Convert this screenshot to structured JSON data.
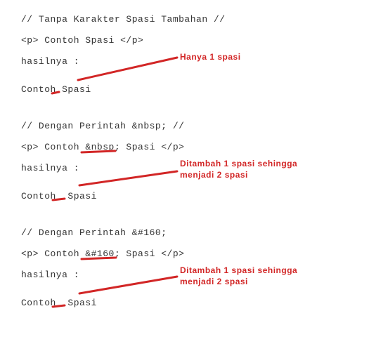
{
  "block1": {
    "comment": "// Tanpa Karakter Spasi Tambahan //",
    "code": "<p> Contoh Spasi </p>",
    "result_label": "hasilnya :",
    "result": "Contoh Spasi",
    "annotation": "Hanya 1 spasi"
  },
  "block2": {
    "comment": "// Dengan Perintah &nbsp; //",
    "code": "<p> Contoh &nbsp; Spasi </p>",
    "result_label": "hasilnya :",
    "result": "Contoh  Spasi",
    "annotation": "Ditambah 1 spasi sehingga\nmenjadi 2 spasi"
  },
  "block3": {
    "comment": "// Dengan Perintah &#160;",
    "code": "<p> Contoh &#160; Spasi </p>",
    "result_label": "hasilnya :",
    "result": "Contoh  Spasi",
    "annotation": "Ditambah 1 spasi sehingga\nmenjadi 2 spasi"
  }
}
